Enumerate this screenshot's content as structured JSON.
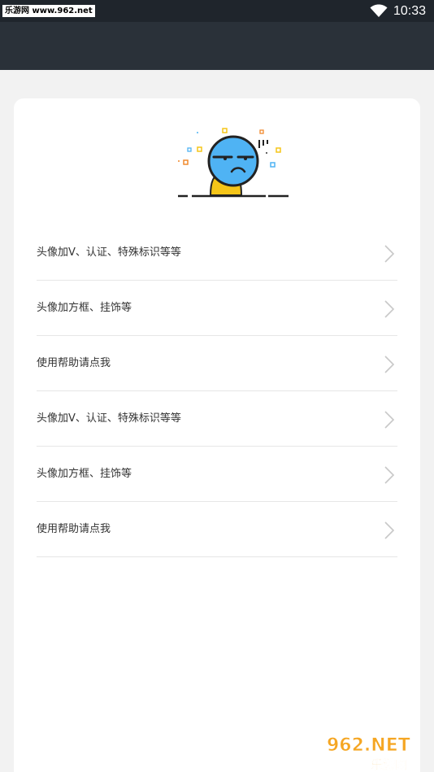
{
  "status_bar": {
    "watermark": "乐游网 www.962.net",
    "time": "10:33",
    "icons": [
      "wifi-icon"
    ]
  },
  "list": {
    "items": [
      {
        "label": "头像加V、认证、特殊标识等等",
        "icon": "chevron-right-icon"
      },
      {
        "label": "头像加方框、挂饰等",
        "icon": "chevron-right-icon"
      },
      {
        "label": "使用帮助请点我",
        "icon": "chevron-right-icon"
      },
      {
        "label": "头像加V、认证、特殊标识等等",
        "icon": "chevron-right-icon"
      },
      {
        "label": "头像加方框、挂饰等",
        "icon": "chevron-right-icon"
      },
      {
        "label": "使用帮助请点我",
        "icon": "chevron-right-icon"
      }
    ]
  },
  "watermark_logo": {
    "text_top": "962.NET",
    "text_bottom": "乐游网"
  },
  "colors": {
    "status_bar_bg": "#1f252c",
    "app_bar_bg": "#2a3139",
    "page_bg": "#f2f2f2",
    "card_bg": "#ffffff",
    "mascot_face": "#4fb3f4",
    "mascot_body": "#f5c518"
  }
}
